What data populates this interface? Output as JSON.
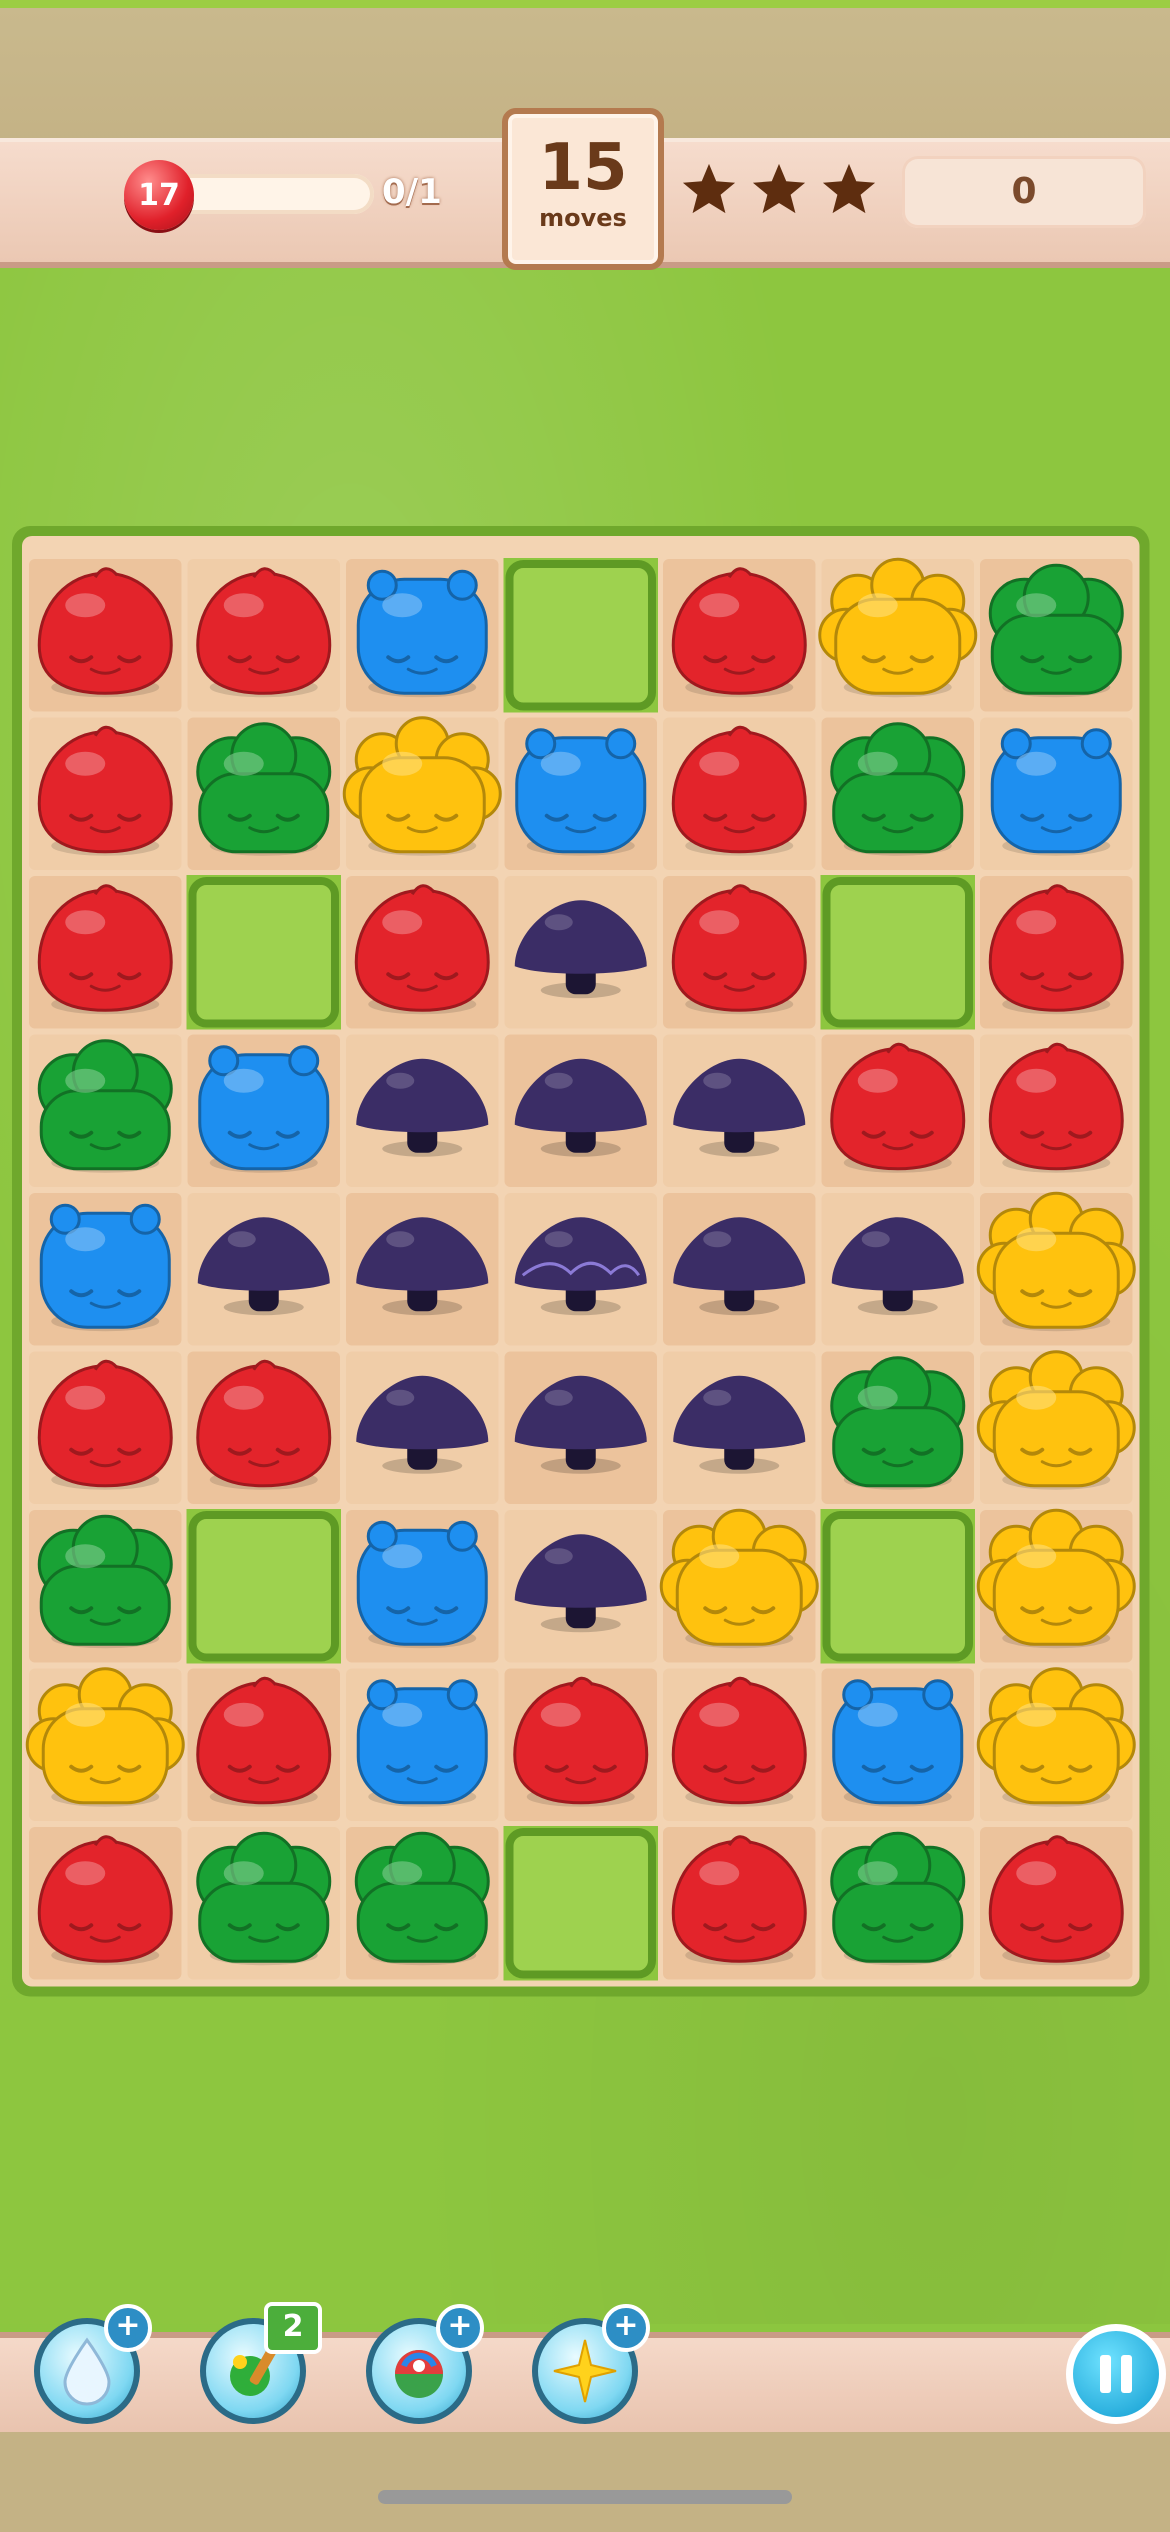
{
  "hud": {
    "lives": "17",
    "life_progress": 0,
    "life_count": "0/1",
    "moves_value": "15",
    "moves_label": "moves",
    "stars": [
      "star-empty",
      "star-empty",
      "star-empty"
    ],
    "score": "0"
  },
  "colors": {
    "red": "#e3242b",
    "blue": "#1e8ff0",
    "green": "#19a235",
    "yellow": "#ffc20e",
    "mushroom": "#3b2d66",
    "cell": "#f0ccaa",
    "grass": "#8dc63f"
  },
  "board": {
    "cols": 7,
    "rows": 9,
    "grid": [
      [
        "red",
        "red",
        "blue",
        "hedge",
        "red",
        "yellow",
        "green"
      ],
      [
        "red",
        "green",
        "yellow",
        "blue",
        "red",
        "green",
        "blue"
      ],
      [
        "red",
        "hedge",
        "red",
        "mushroom",
        "red",
        "hedge",
        "red"
      ],
      [
        "green",
        "blue",
        "mushroom",
        "mushroom",
        "mushroom",
        "red",
        "red"
      ],
      [
        "blue",
        "mushroom",
        "mushroom",
        "mushroom-striped",
        "mushroom",
        "mushroom",
        "yellow"
      ],
      [
        "red",
        "red",
        "mushroom",
        "mushroom",
        "mushroom",
        "green",
        "yellow"
      ],
      [
        "green",
        "hedge",
        "blue",
        "mushroom",
        "yellow",
        "hedge",
        "yellow"
      ],
      [
        "yellow",
        "red",
        "blue",
        "red",
        "red",
        "blue",
        "yellow"
      ],
      [
        "red",
        "green",
        "green",
        "hedge",
        "red",
        "green",
        "red"
      ]
    ]
  },
  "boosters": [
    {
      "name": "water-drop-booster",
      "badge_type": "plus",
      "badge": "+"
    },
    {
      "name": "paint-brush-booster",
      "badge_type": "count",
      "badge": "2"
    },
    {
      "name": "rainbow-ball-booster",
      "badge_type": "plus",
      "badge": "+"
    },
    {
      "name": "sparkle-star-booster",
      "badge_type": "plus",
      "badge": "+"
    }
  ]
}
